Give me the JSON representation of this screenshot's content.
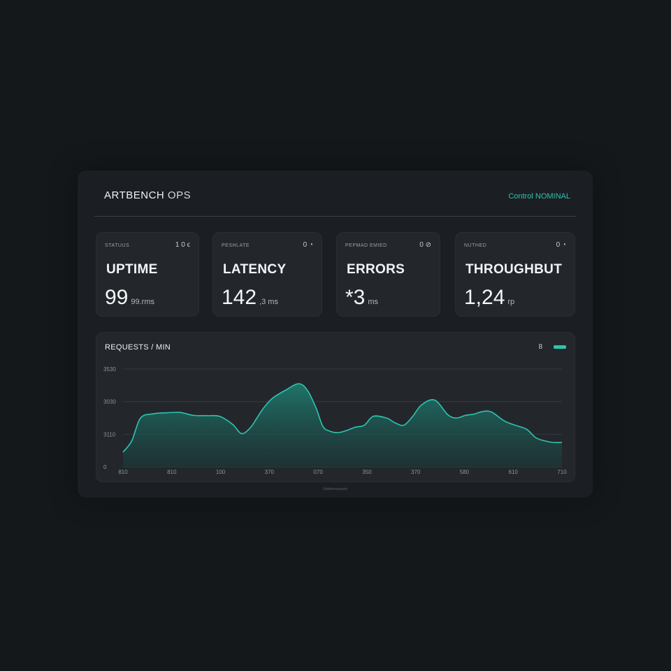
{
  "app": {
    "brand": "ARTBENCH",
    "brand_suffix": "OPS",
    "status": "Control NOMINAL",
    "accent_color": "#2ec4b0"
  },
  "cards": [
    {
      "label": "STATUUS",
      "icons": "1  0  ϵ",
      "title": "UPTIME",
      "value": "99",
      "unit": "99.rms"
    },
    {
      "label": "PESHLATE",
      "icons": "0  ◔",
      "title": "LATENCY",
      "value": "142",
      "unit": ",3 ms"
    },
    {
      "label": "PEPMAD EMIED",
      "icons": "0  ⊘",
      "title": "ERRORS",
      "value": "*3",
      "unit": "ms"
    },
    {
      "label": "NUTHED",
      "icons": "0  ◔",
      "title": "THROUGHBUT",
      "value": "1,24",
      "unit": "rp"
    }
  ],
  "chart": {
    "title": "REQUESTS / MIN",
    "legend_icon": "8",
    "footnote": "Uptimerequests"
  },
  "chart_data": {
    "type": "area",
    "y_ticks": [
      "3530",
      "3030",
      "3110",
      "0"
    ],
    "ylim": [
      0,
      3
    ],
    "x_ticks": [
      "810",
      "810",
      "100",
      "370",
      "070",
      "350",
      "370",
      "580",
      "610",
      "710"
    ],
    "series": [
      {
        "color": "#2ec4b0",
        "x": [
          0.0,
          0.02,
          0.04,
          0.07,
          0.1,
          0.13,
          0.16,
          0.19,
          0.22,
          0.25,
          0.27,
          0.29,
          0.305,
          0.32,
          0.34,
          0.37,
          0.4,
          0.42,
          0.44,
          0.455,
          0.47,
          0.49,
          0.51,
          0.53,
          0.55,
          0.57,
          0.6,
          0.62,
          0.64,
          0.66,
          0.68,
          0.71,
          0.74,
          0.76,
          0.78,
          0.8,
          0.82,
          0.84,
          0.87,
          0.9,
          0.92,
          0.94,
          0.96,
          0.98,
          1.0
        ],
        "y": [
          0.45,
          0.8,
          1.5,
          1.63,
          1.66,
          1.67,
          1.58,
          1.57,
          1.55,
          1.3,
          1.02,
          1.2,
          1.5,
          1.8,
          2.1,
          2.35,
          2.55,
          2.35,
          1.8,
          1.25,
          1.1,
          1.05,
          1.12,
          1.22,
          1.28,
          1.55,
          1.5,
          1.35,
          1.28,
          1.55,
          1.9,
          2.05,
          1.6,
          1.5,
          1.58,
          1.62,
          1.7,
          1.68,
          1.4,
          1.25,
          1.15,
          0.9,
          0.8,
          0.75,
          0.75
        ]
      }
    ]
  }
}
